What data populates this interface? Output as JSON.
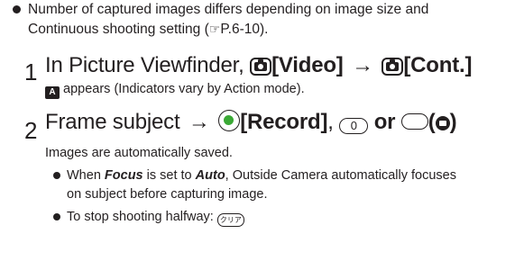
{
  "note": {
    "line1": "Number of captured images differs depending on image size and",
    "line2_a": "Continuous shooting setting (",
    "line2_icon": "☞",
    "line2_ref": "P.6-10",
    "line2_b": ")."
  },
  "step1": {
    "number": "1",
    "prefix": "In Picture Viewfinder,",
    "key1_label": "[Video]",
    "arrow": "→",
    "key2_label": "[Cont.]",
    "sub_text": "appears (Indicators vary by Action mode).",
    "indicator_icon_label": "A"
  },
  "step2": {
    "number": "2",
    "prefix": "Frame subject",
    "arrow": "→",
    "record_label": "[Record]",
    "comma": ",",
    "zero_key": "0",
    "or": "or",
    "sub_text": "Images are automatically saved.",
    "bullet1_a": "When ",
    "bullet1_focus": "Focus",
    "bullet1_b": " is set to ",
    "bullet1_auto": "Auto",
    "bullet1_c": ", Outside Camera automatically focuses",
    "bullet1_line2": "on subject before capturing image.",
    "bullet2": "To stop shooting halfway:",
    "clear_key": "クリア"
  }
}
